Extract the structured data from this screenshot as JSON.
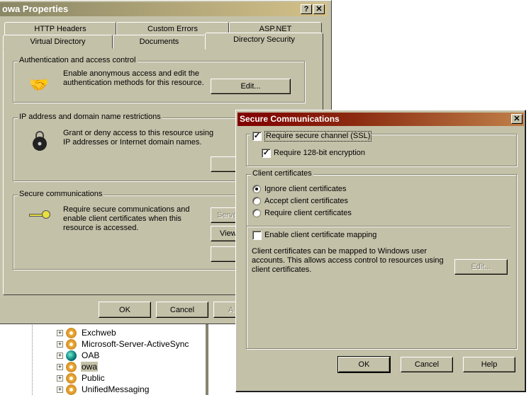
{
  "main_window": {
    "title": "owa Properties",
    "help_btn": "?",
    "close_btn": "✕",
    "tabs_row1": [
      "HTTP Headers",
      "Custom Errors",
      "ASP.NET"
    ],
    "tabs_row2": [
      "Virtual Directory",
      "Documents",
      "Directory Security"
    ],
    "active_tab": "Directory Security",
    "auth": {
      "legend": "Authentication and access control",
      "text": "Enable anonymous access and edit the authentication methods for this resource.",
      "edit": "Edit..."
    },
    "ip": {
      "legend": "IP address and domain name restrictions",
      "text": "Grant or deny access to this resource using IP addresses or Internet domain names."
    },
    "secure": {
      "legend": "Secure communications",
      "text": "Require secure communications and enable client certificates when this resource is accessed.",
      "server_btn": "Serve",
      "view_btn": "View"
    },
    "ok": "OK",
    "cancel": "Cancel",
    "apply": "A"
  },
  "tree": {
    "items": [
      {
        "label": "Exchweb",
        "icon": "gear-icon"
      },
      {
        "label": "Microsoft-Server-ActiveSync",
        "icon": "gear-icon"
      },
      {
        "label": "OAB",
        "icon": "globe-folder-icon"
      },
      {
        "label": "owa",
        "icon": "gear-icon",
        "selected": true
      },
      {
        "label": "Public",
        "icon": "gear-icon"
      },
      {
        "label": "UnifiedMessaging",
        "icon": "gear-icon"
      }
    ]
  },
  "dialog": {
    "title": "Secure Communications",
    "close": "✕",
    "require_ssl": {
      "label": "Require secure channel (SSL)",
      "checked": true
    },
    "require_128": {
      "label": "Require 128-bit encryption",
      "checked": true
    },
    "client_certs_legend": "Client certificates",
    "radios": [
      {
        "label": "Ignore client certificates",
        "selected": true
      },
      {
        "label": "Accept client certificates",
        "selected": false
      },
      {
        "label": "Require client certificates",
        "selected": false
      }
    ],
    "mapping": {
      "label": "Enable client certificate mapping",
      "checked": false
    },
    "mapping_text": "Client certificates can be mapped to Windows user accounts.  This allows access control to resources using client certificates.",
    "edit": "Edit...",
    "ok": "OK",
    "cancel": "Cancel",
    "help": "Help"
  },
  "colors": {
    "face": "#c4c1a9",
    "main_title": "#8a8766",
    "dialog_title": "#800000"
  }
}
